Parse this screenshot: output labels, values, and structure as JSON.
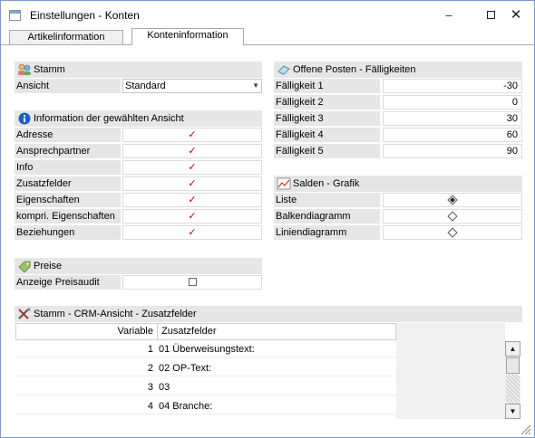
{
  "window": {
    "title": "Einstellungen - Konten"
  },
  "tabs": [
    {
      "label": "Artikelinformation",
      "underline_char": "A",
      "rest": "rtikelinformation",
      "active": false
    },
    {
      "label": "Konteninformation",
      "underline_char": "K",
      "rest": "onteninformation",
      "active": true
    }
  ],
  "stamm": {
    "header": "Stamm",
    "ansicht_label": "Ansicht",
    "ansicht_value": "Standard"
  },
  "info": {
    "header": "Information der gewählten Ansicht",
    "rows": [
      {
        "label": "Adresse",
        "checked": true
      },
      {
        "label": "Ansprechpartner",
        "checked": true
      },
      {
        "label": "Info",
        "checked": true
      },
      {
        "label": "Zusatzfelder",
        "checked": true
      },
      {
        "label": "Eigenschaften",
        "checked": true
      },
      {
        "label": "kompri. Eigenschaften",
        "checked": true
      },
      {
        "label": "Beziehungen",
        "checked": true
      }
    ]
  },
  "preise": {
    "header": "Preise",
    "rows": [
      {
        "label": "Anzeige Preisaudit",
        "checked": false
      }
    ]
  },
  "offene": {
    "header": "Offene Posten - Fälligkeiten",
    "rows": [
      {
        "label": "Fälligkeit 1",
        "value": "-30"
      },
      {
        "label": "Fälligkeit 2",
        "value": "0"
      },
      {
        "label": "Fälligkeit 3",
        "value": "30"
      },
      {
        "label": "Fälligkeit 4",
        "value": "60"
      },
      {
        "label": "Fälligkeit 5",
        "value": "90"
      }
    ]
  },
  "salden": {
    "header": "Salden - Grafik",
    "rows": [
      {
        "label": "Liste",
        "selected": true
      },
      {
        "label": "Balkendiagramm",
        "selected": false
      },
      {
        "label": "Liniendiagramm",
        "selected": false
      }
    ]
  },
  "crm": {
    "header": "Stamm - CRM-Ansicht - Zusatzfelder",
    "col_variable": "Variable",
    "col_zusatzfelder": "Zusatzfelder",
    "rows": [
      {
        "variable": "1",
        "zusatz": "01  Überweisungstext:"
      },
      {
        "variable": "2",
        "zusatz": "02  OP-Text:"
      },
      {
        "variable": "3",
        "zusatz": "03"
      },
      {
        "variable": "4",
        "zusatz": "04  Branche:"
      }
    ]
  },
  "colors": {
    "section_bg": "#e6e6e6",
    "check_red": "#c00000",
    "border_blue": "#7a9cc7"
  }
}
